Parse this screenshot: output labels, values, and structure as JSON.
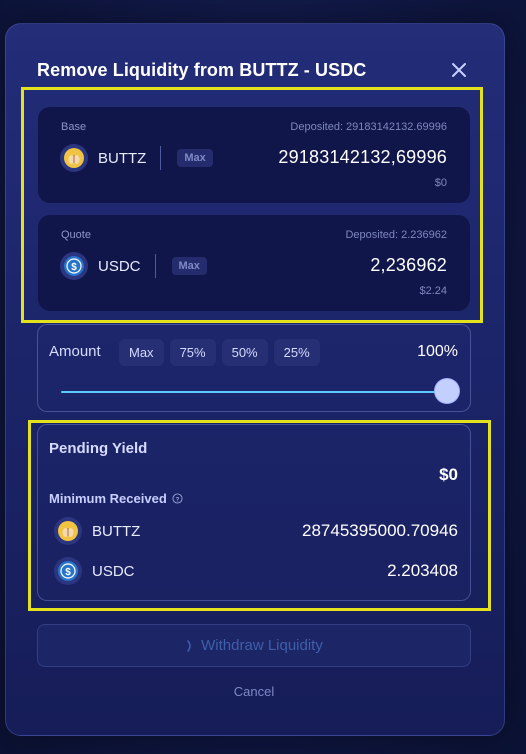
{
  "dialog": {
    "title": "Remove Liquidity from BUTTZ - USDC"
  },
  "base": {
    "label": "Base",
    "deposited": "Deposited: 29183142132.69996",
    "token": "BUTTZ",
    "max_label": "Max",
    "amount": "29183142132,69996",
    "usd": "$0"
  },
  "quote": {
    "label": "Quote",
    "deposited": "Deposited: 2.236962",
    "token": "USDC",
    "max_label": "Max",
    "amount": "2,236962",
    "usd": "$2.24"
  },
  "amount": {
    "label": "Amount",
    "buttons": [
      "Max",
      "75%",
      "50%",
      "25%"
    ],
    "value": "100%",
    "slider_fraction": 1.0
  },
  "yield": {
    "pending_label": "Pending Yield",
    "pending_value": "$0",
    "min_received_label": "Minimum Received",
    "rows": [
      {
        "token": "BUTTZ",
        "amount": "28745395000.70946"
      },
      {
        "token": "USDC",
        "amount": "2.203408"
      }
    ]
  },
  "actions": {
    "withdraw_label": "Withdraw Liquidity",
    "cancel_label": "Cancel"
  },
  "colors": {
    "highlight": "#e4e21c",
    "slider": "#5ec9ff",
    "usdc": "#2775ca",
    "buttz": "#f0c343"
  },
  "icons": {
    "close": "close-icon",
    "base_token": "buttz-token-icon",
    "quote_token": "usdc-token-icon",
    "help": "help-circle-icon"
  }
}
